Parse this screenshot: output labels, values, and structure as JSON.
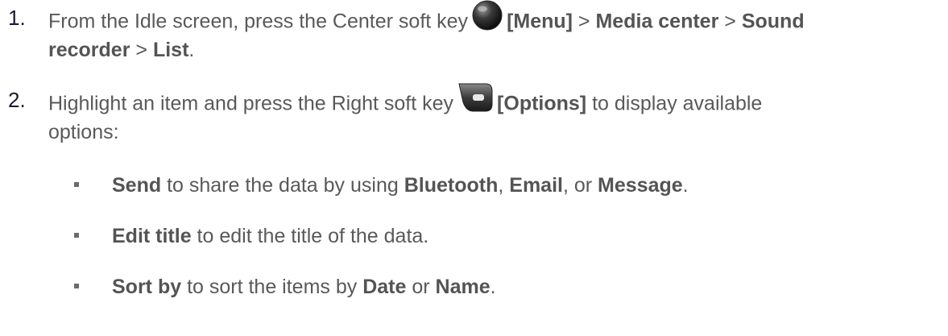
{
  "steps": [
    {
      "number": "1.",
      "line1": {
        "pre": "From the Idle screen, press the Center soft key",
        "key_label": "[Menu]",
        "sep1": " > ",
        "b1": "Media center",
        "sep2": " > ",
        "b2": "Sound"
      },
      "line2": {
        "b1": "recorder",
        "sep": " > ",
        "b2": "List",
        "end": "."
      },
      "icon": "center-soft-key-icon"
    },
    {
      "number": "2.",
      "line1": {
        "pre": "Highlight an item and press the Right soft key",
        "key_label": "[Options]",
        "post": " to display available"
      },
      "line2": {
        "text": "options:"
      },
      "icon": "right-soft-key-icon"
    }
  ],
  "bullets": [
    {
      "b": "Send",
      "t1": " to share the data by using ",
      "b2": "Bluetooth",
      "t2": ", ",
      "b3": "Email",
      "t3": ", or ",
      "b4": "Message",
      "t4": "."
    },
    {
      "b": "Edit title",
      "t1": " to edit the title of the data."
    },
    {
      "b": "Sort by",
      "t1": " to sort the items by ",
      "b2": "Date",
      "t2": " or ",
      "b3": "Name",
      "t3": "."
    }
  ]
}
